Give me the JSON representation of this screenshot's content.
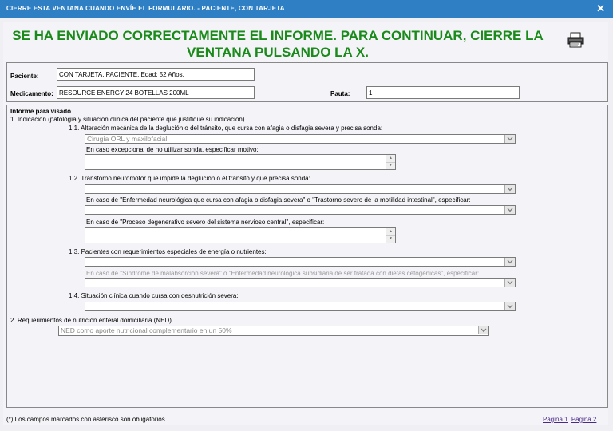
{
  "window": {
    "title": "CIERRE ESTA VENTANA CUANDO ENVÍE EL FORMULARIO. - PACIENTE, CON TARJETA",
    "close_label": "✕"
  },
  "banner": {
    "message": "SE HA ENVIADO CORRECTAMENTE EL INFORME. PARA CONTINUAR, CIERRE LA VENTANA PULSANDO LA X.",
    "print_icon": "printer-icon"
  },
  "patient": {
    "paciente_label": "Paciente:",
    "paciente_value": "CON TARJETA, PACIENTE. Edad: 52 Años.",
    "medicamento_label": "Medicamento:",
    "medicamento_value": "RESOURCE ENERGY 24 BOTELLAS 200ML",
    "pauta_label": "Pauta:",
    "pauta_value": "1"
  },
  "informe": {
    "heading": "Informe para visado",
    "q1": "1. Indicación (patología y situación clínica del paciente que justifique su indicación)",
    "q1_1": "1.1. Alteración mecánica de la deglución o del tránsito, que cursa con afagia o disfagia severa y precisa sonda:",
    "q1_1_select": "Cirugía ORL y maxilofacial",
    "q1_1_exc": "En caso excepcional de no utilizar sonda, especificar motivo:",
    "q1_2": "1.2. Transtorno neuromotor que impide la deglución o el tránsito y que precisa sonda:",
    "q1_2_case1": "En caso de \"Enfermedad neurológica que cursa con afagia o disfagia severa\" o \"Trastorno severo de la motilidad intestinal\", especificar:",
    "q1_2_case2": "En caso de \"Proceso degenerativo severo del sistema nervioso central\", especificar:",
    "q1_3": "1.3. Pacientes con requerimientos especiales de energía o nutrientes:",
    "q1_3_case": "En caso de \"Síndrome de malabsorción severa\" o \"Enfermedad neurológica subsidiaria de ser tratada con dietas cetogénicas\", especificar:",
    "q1_4": "1.4. Situación clínica cuando cursa con desnutrición severa:",
    "q2": "2. Requerimientos de nutrición enteral domiciliaria (NED)",
    "q2_select": "NED como aporte nutricional complementario en un 50%"
  },
  "footer": {
    "note": "(*) Los campos marcados con asterisco son obligatorios.",
    "page1": "Página 1",
    "page2": "Página 2"
  },
  "colors": {
    "titlebar": "#2f7fc4",
    "banner_text": "#1a8a1a",
    "link": "#4a2a88"
  }
}
